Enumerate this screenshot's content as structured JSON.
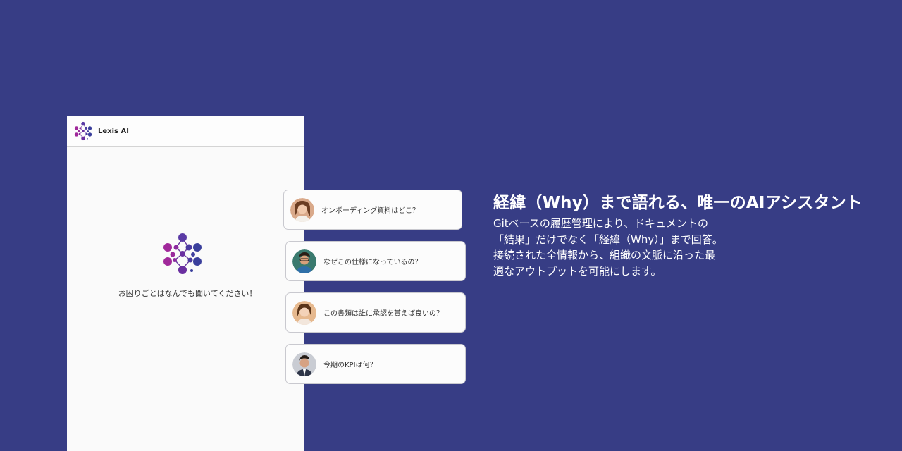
{
  "app": {
    "title": "Lexis AI",
    "logo_icon": "molecule-logo-icon",
    "prompt": "お困りごとはなんでも聞いてください！"
  },
  "suggestions": [
    {
      "label": "オンボーディング資料はどこ？",
      "avatar": "woman-avatar-icon",
      "avatar_color": "#d9a98a"
    },
    {
      "label": "なぜこの仕様になっているの？",
      "avatar": "man-avatar-icon",
      "avatar_color": "#3a7a6e"
    },
    {
      "label": "この書類は誰に承認を貰えば良いの？",
      "avatar": "woman-avatar-icon",
      "avatar_color": "#e6b98f"
    },
    {
      "label": "今期のKPIは何？",
      "avatar": "man-suit-avatar-icon",
      "avatar_color": "#2e3548"
    }
  ],
  "feature": {
    "title": "経緯（Why）まで語れる、唯一のAIアシスタント",
    "lines": [
      "Gitベースの履歴管理により、ドキュメントの",
      "「結果」だけでなく「経緯（Why）」まで回答。",
      "接続された全情報から、組織の文脈に沿った最",
      "適なアウトプットを可能にします。"
    ]
  },
  "colors": {
    "background": "#373d85",
    "logo_purple": "#8a2a9e",
    "logo_blue": "#3a3f9c"
  }
}
